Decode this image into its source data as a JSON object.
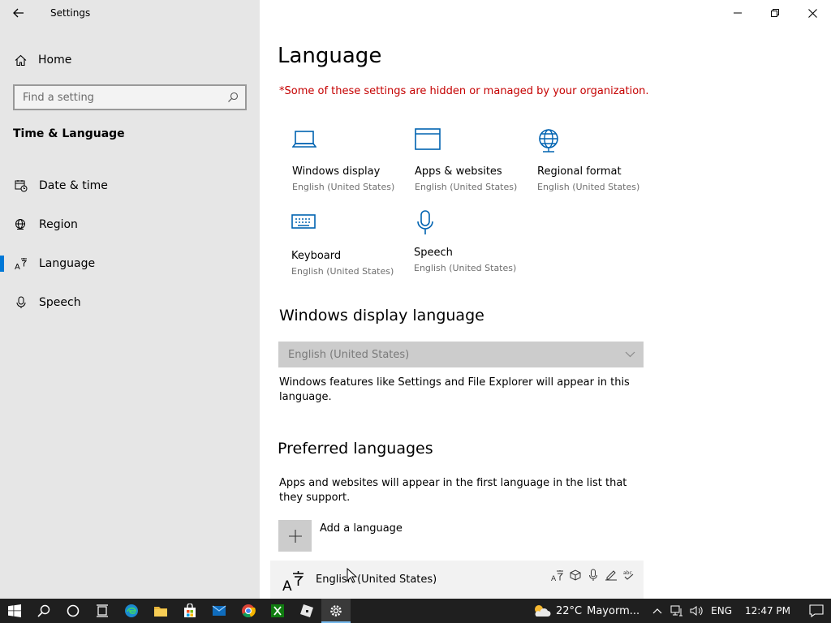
{
  "window": {
    "app_title": "Settings"
  },
  "sidebar": {
    "home_label": "Home",
    "search_placeholder": "Find a setting",
    "section_title": "Time & Language",
    "items": [
      {
        "label": "Date & time",
        "icon": "calendar-clock-icon"
      },
      {
        "label": "Region",
        "icon": "globe-icon"
      },
      {
        "label": "Language",
        "icon": "language-icon",
        "active": true
      },
      {
        "label": "Speech",
        "icon": "microphone-icon"
      }
    ]
  },
  "main": {
    "page_title": "Language",
    "managed_note": "*Some of these settings are hidden or managed by your organization.",
    "tiles": [
      {
        "title": "Windows display",
        "subtitle": "English (United States)",
        "icon": "laptop-icon"
      },
      {
        "title": "Apps & websites",
        "subtitle": "English (United States)",
        "icon": "browser-window-icon"
      },
      {
        "title": "Regional format",
        "subtitle": "English (United States)",
        "icon": "globe-icon"
      },
      {
        "title": "Keyboard",
        "subtitle": "English (United States)",
        "icon": "keyboard-icon"
      },
      {
        "title": "Speech",
        "subtitle": "English (United States)",
        "icon": "microphone-icon"
      }
    ],
    "display_language": {
      "heading": "Windows display language",
      "selected": "English (United States)",
      "description": "Windows features like Settings and File Explorer will appear in this language."
    },
    "preferred": {
      "heading": "Preferred languages",
      "description": "Apps and websites will appear in the first language in the list that they support.",
      "add_label": "Add a language",
      "languages": [
        {
          "label": "English (United States)"
        }
      ]
    }
  },
  "taskbar": {
    "weather_temp": "22°C",
    "weather_text": "Mayorm...",
    "input_lang": "ENG",
    "time": "12:47 PM"
  },
  "colors": {
    "accent": "#0078d7",
    "warning": "#c50000",
    "sidebar_bg": "#e6e6e6",
    "taskbar_bg": "#1f1f1f"
  }
}
